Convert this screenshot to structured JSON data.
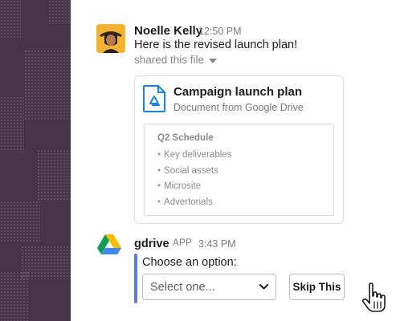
{
  "message": {
    "author": "Noelle Kelly",
    "time": "12:50 PM",
    "text": "Here is the revised launch plan!",
    "shared_label": "shared this file"
  },
  "file_card": {
    "title": "Campaign launch plan",
    "subtitle": "Document from Google Drive",
    "icon": "google-docs-icon",
    "preview": {
      "heading": "Q2 Schedule",
      "items": [
        "Key deliverables",
        "Social assets",
        "Microsite",
        "Advertorials"
      ]
    }
  },
  "app_message": {
    "name": "gdrive",
    "badge": "APP",
    "time": "3:43 PM",
    "prompt": "Choose an option:",
    "select_placeholder": "Select one...",
    "skip_label": "Skip This",
    "icon": "google-drive-icon"
  },
  "colors": {
    "sidebar": "#4a3248",
    "attachment_bar": "#5d7ad8",
    "doc_icon": "#1b84d8"
  }
}
